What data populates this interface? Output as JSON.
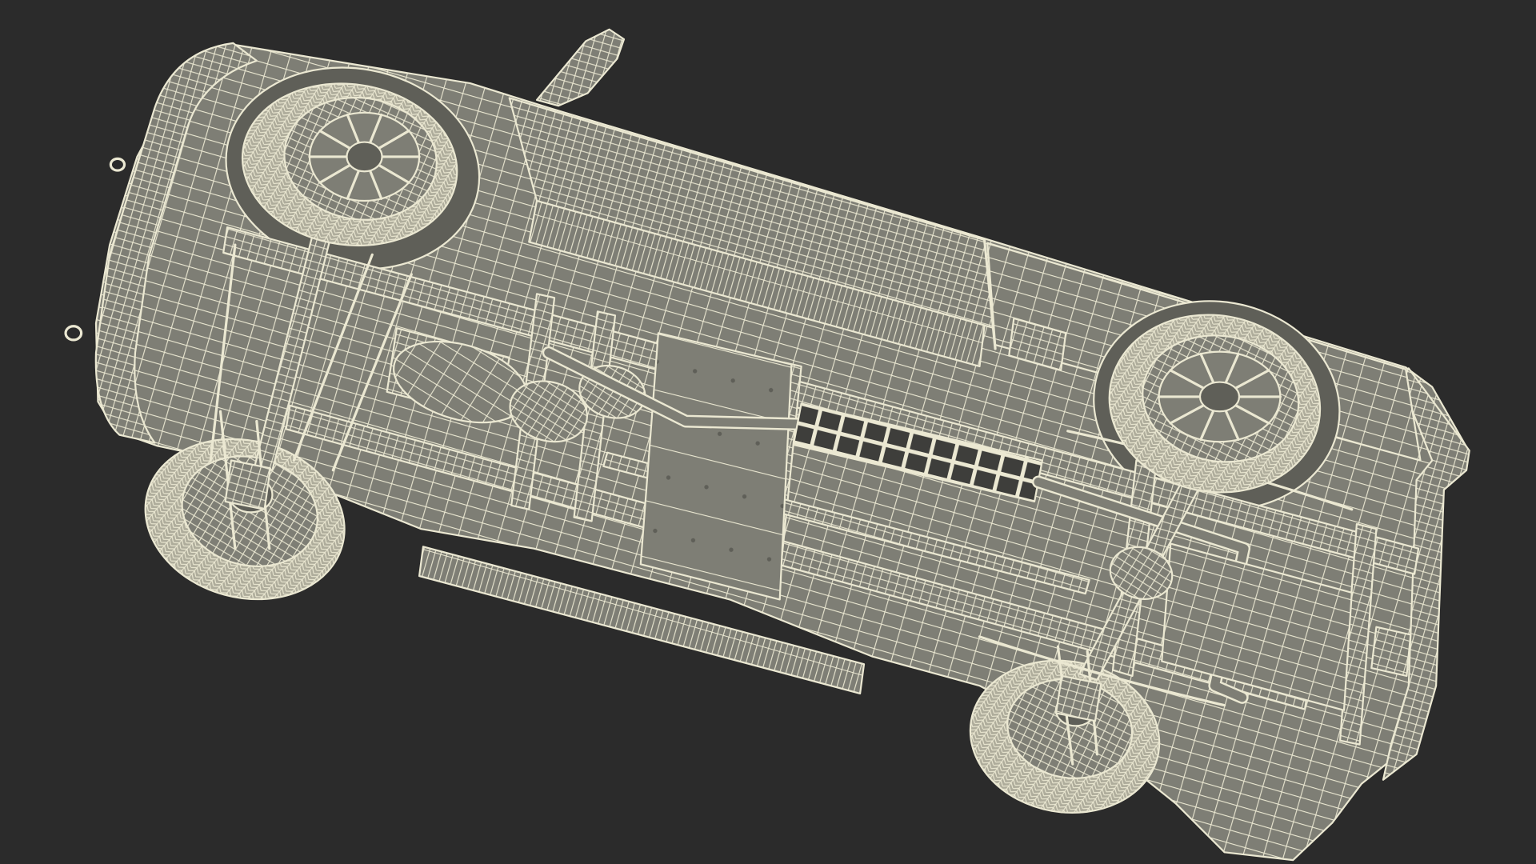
{
  "colors": {
    "background": "#2b2b2b",
    "surface": "#7e7e75",
    "wire": "#ebe8d2",
    "shade": "#5f5f58",
    "tread": "#aeac9b"
  }
}
